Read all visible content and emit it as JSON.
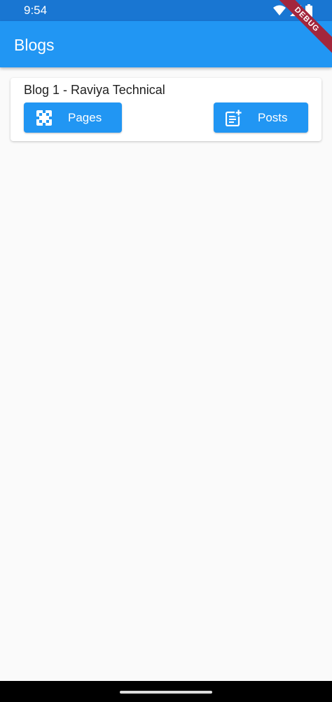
{
  "status_bar": {
    "time": "9:54"
  },
  "app_bar": {
    "title": "Blogs"
  },
  "debug_banner": {
    "label": "DEBUG"
  },
  "blogs": [
    {
      "title": "Blog 1 - Raviya Technical",
      "pages_label": "Pages",
      "posts_label": "Posts"
    }
  ],
  "icons": {
    "pages": "pages-icon",
    "posts": "post-add-icon",
    "wifi": "wifi-icon",
    "signal": "signal-icon",
    "battery": "battery-icon"
  },
  "colors": {
    "status_bar": "#1976d2",
    "app_bar": "#2196f3",
    "button": "#2196f3",
    "background": "#fafafa",
    "debug_ribbon": "#a3263c"
  }
}
